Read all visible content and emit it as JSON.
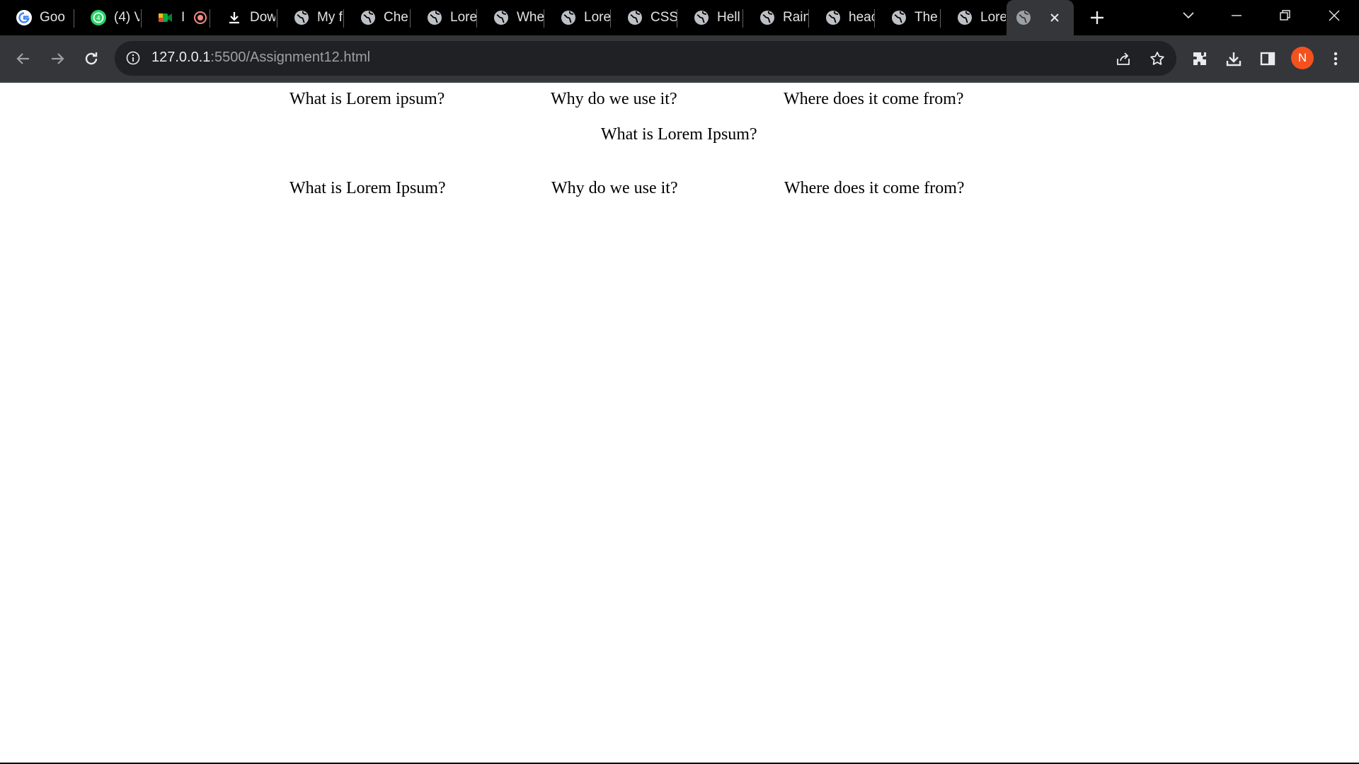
{
  "browser": {
    "tabs": [
      {
        "label": "Goo",
        "icon": "google-icon"
      },
      {
        "label": "(4) V",
        "icon": "whatsapp-icon"
      },
      {
        "label": "I",
        "icon": "google-meet-icon"
      },
      {
        "label": "Dow",
        "icon": "download-icon"
      },
      {
        "label": "My f",
        "icon": "globe-icon"
      },
      {
        "label": "Che",
        "icon": "globe-icon"
      },
      {
        "label": "Lore",
        "icon": "globe-icon"
      },
      {
        "label": "Whe",
        "icon": "globe-icon"
      },
      {
        "label": "Lore",
        "icon": "globe-icon"
      },
      {
        "label": "CSS",
        "icon": "globe-icon"
      },
      {
        "label": "Hell",
        "icon": "globe-icon"
      },
      {
        "label": "Rain",
        "icon": "globe-icon"
      },
      {
        "label": "heac",
        "icon": "globe-icon"
      },
      {
        "label": "The",
        "icon": "globe-icon"
      },
      {
        "label": "Lore",
        "icon": "globe-icon"
      }
    ],
    "active_tab": {
      "icon": "globe-icon"
    },
    "url_host": "127.0.0.1",
    "url_path": ":5500/Assignment12.html",
    "profile_initial": "N",
    "colors": {
      "tabstrip": "#000000",
      "toolbar": "#35363a",
      "omnibox": "#202124",
      "avatar": "#f4511e"
    }
  },
  "page": {
    "top_nav": [
      "What is Lorem ipsum?",
      "Why do we use it?",
      "Where does it come from?"
    ],
    "center_heading": "What is Lorem Ipsum?",
    "bottom_nav": [
      "What is Lorem Ipsum?",
      "Why do we use it?",
      "Where does it come from?"
    ]
  }
}
